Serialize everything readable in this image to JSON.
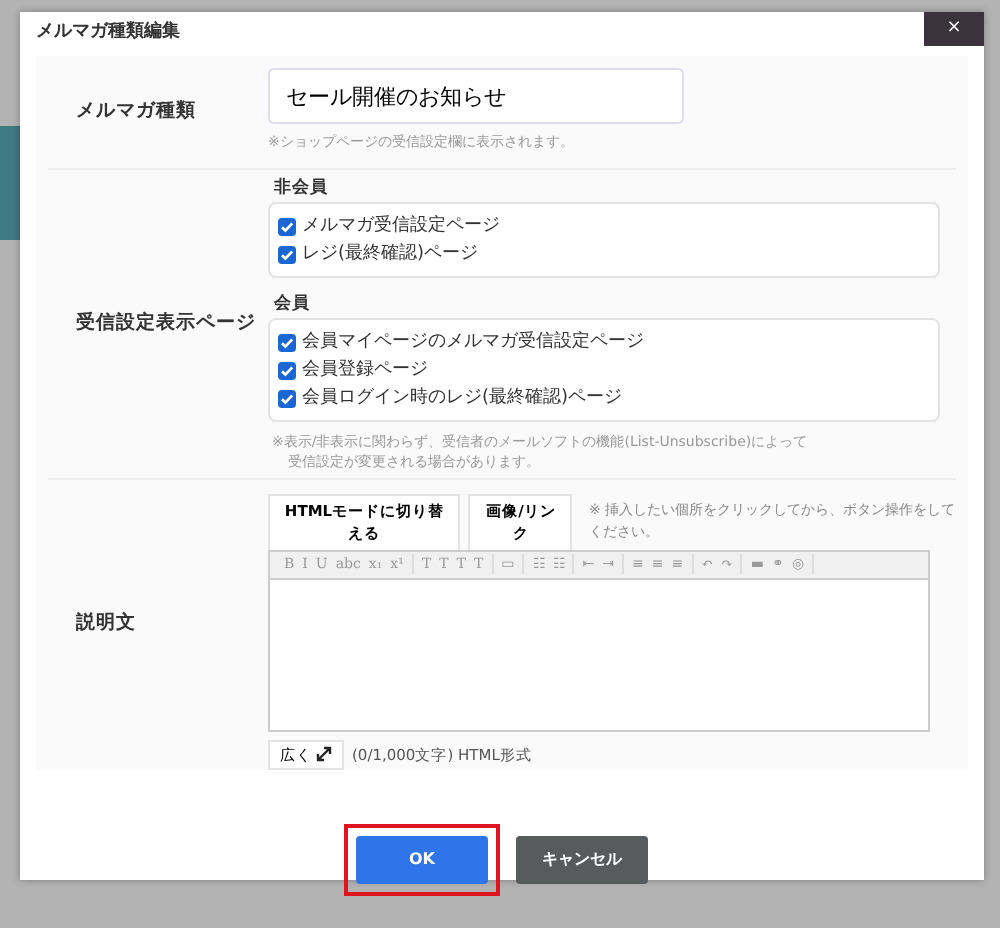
{
  "dialog": {
    "title": "メルマガ種類編集",
    "close": "×"
  },
  "name_row": {
    "label": "メルマガ種類",
    "value": "セール開催のお知らせ",
    "hint": "※ショップページの受信設定欄に表示されます。"
  },
  "pages_row": {
    "label": "受信設定表示ページ",
    "groups": [
      {
        "legend": "非会員",
        "items": [
          {
            "label": "メルマガ受信設定ページ",
            "checked": true
          },
          {
            "label": "レジ(最終確認)ページ",
            "checked": true
          }
        ]
      },
      {
        "legend": "会員",
        "items": [
          {
            "label": "会員マイページのメルマガ受信設定ページ",
            "checked": true
          },
          {
            "label": "会員登録ページ",
            "checked": true
          },
          {
            "label": "会員ログイン時のレジ(最終確認)ページ",
            "checked": true
          }
        ]
      }
    ],
    "note": [
      "※表示/非表示に関わらず、受信者のメールソフトの機能(List-Unsubscribe)によって",
      "受信設定が変更される場合があります。"
    ]
  },
  "description_row": {
    "label": "説明文",
    "tabs": [
      "HTMLモードに切り替える",
      "画像/リンク"
    ],
    "tip": "※ 挿入したい個所をクリックしてから、ボタン操作をしてください。",
    "toolbar": [
      [
        "B",
        "I",
        "U",
        "abc",
        "x₁",
        "x¹"
      ],
      [
        "T",
        "T",
        "T",
        "T"
      ],
      [
        "▭"
      ],
      [
        "☷",
        "☷"
      ],
      [
        "⇤",
        "⇥"
      ],
      [
        "≡",
        "≡",
        "≡"
      ],
      [
        "↶",
        "↷"
      ],
      [
        "▬",
        "⚭",
        "◎"
      ]
    ],
    "expand": "広く",
    "counter": "(0/1,000文字) HTML形式"
  },
  "buttons": [
    {
      "label": "OK",
      "kind": "primary",
      "highlighted": true
    },
    {
      "label": "キャンセル",
      "kind": "secondary",
      "highlighted": false
    }
  ]
}
